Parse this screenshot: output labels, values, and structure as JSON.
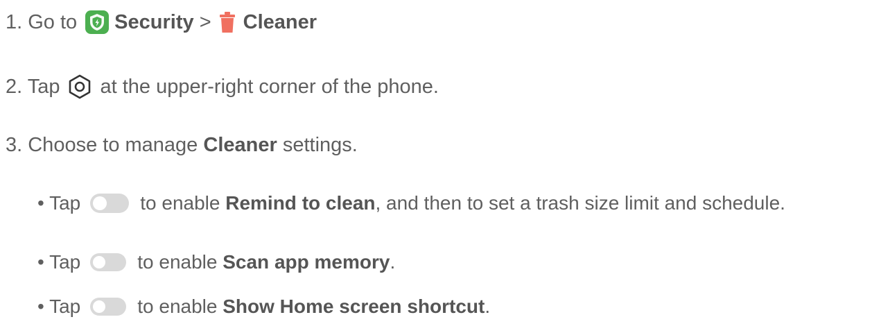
{
  "steps": {
    "s1": {
      "prefix": "1. Go to",
      "security_label": "Security",
      "separator": ">",
      "cleaner_label": "Cleaner",
      "security_icon": "security-shield-icon",
      "cleaner_icon": "trash-icon"
    },
    "s2": {
      "prefix": "2. Tap",
      "suffix": "at the upper-right corner of the phone.",
      "icon": "settings-gear-icon"
    },
    "s3": {
      "prefix": "3. Choose to manage",
      "bold": "Cleaner",
      "suffix": "settings."
    }
  },
  "bullets": [
    {
      "prefix": "• Tap",
      "middle": "to enable",
      "bold": "Remind to clean",
      "suffix": ", and then to set a trash size limit and schedule.",
      "toggle_state": "off"
    },
    {
      "prefix": "• Tap",
      "middle": "to enable",
      "bold": "Scan app memory",
      "suffix": ".",
      "toggle_state": "off"
    },
    {
      "prefix": "• Tap",
      "middle": "to enable",
      "bold": "Show Home screen shortcut",
      "suffix": ".",
      "toggle_state": "off"
    }
  ],
  "colors": {
    "text": "#5f5f5f",
    "security_green": "#4caf50",
    "cleaner_red": "#f07060",
    "toggle_off": "#d9d9d9"
  }
}
